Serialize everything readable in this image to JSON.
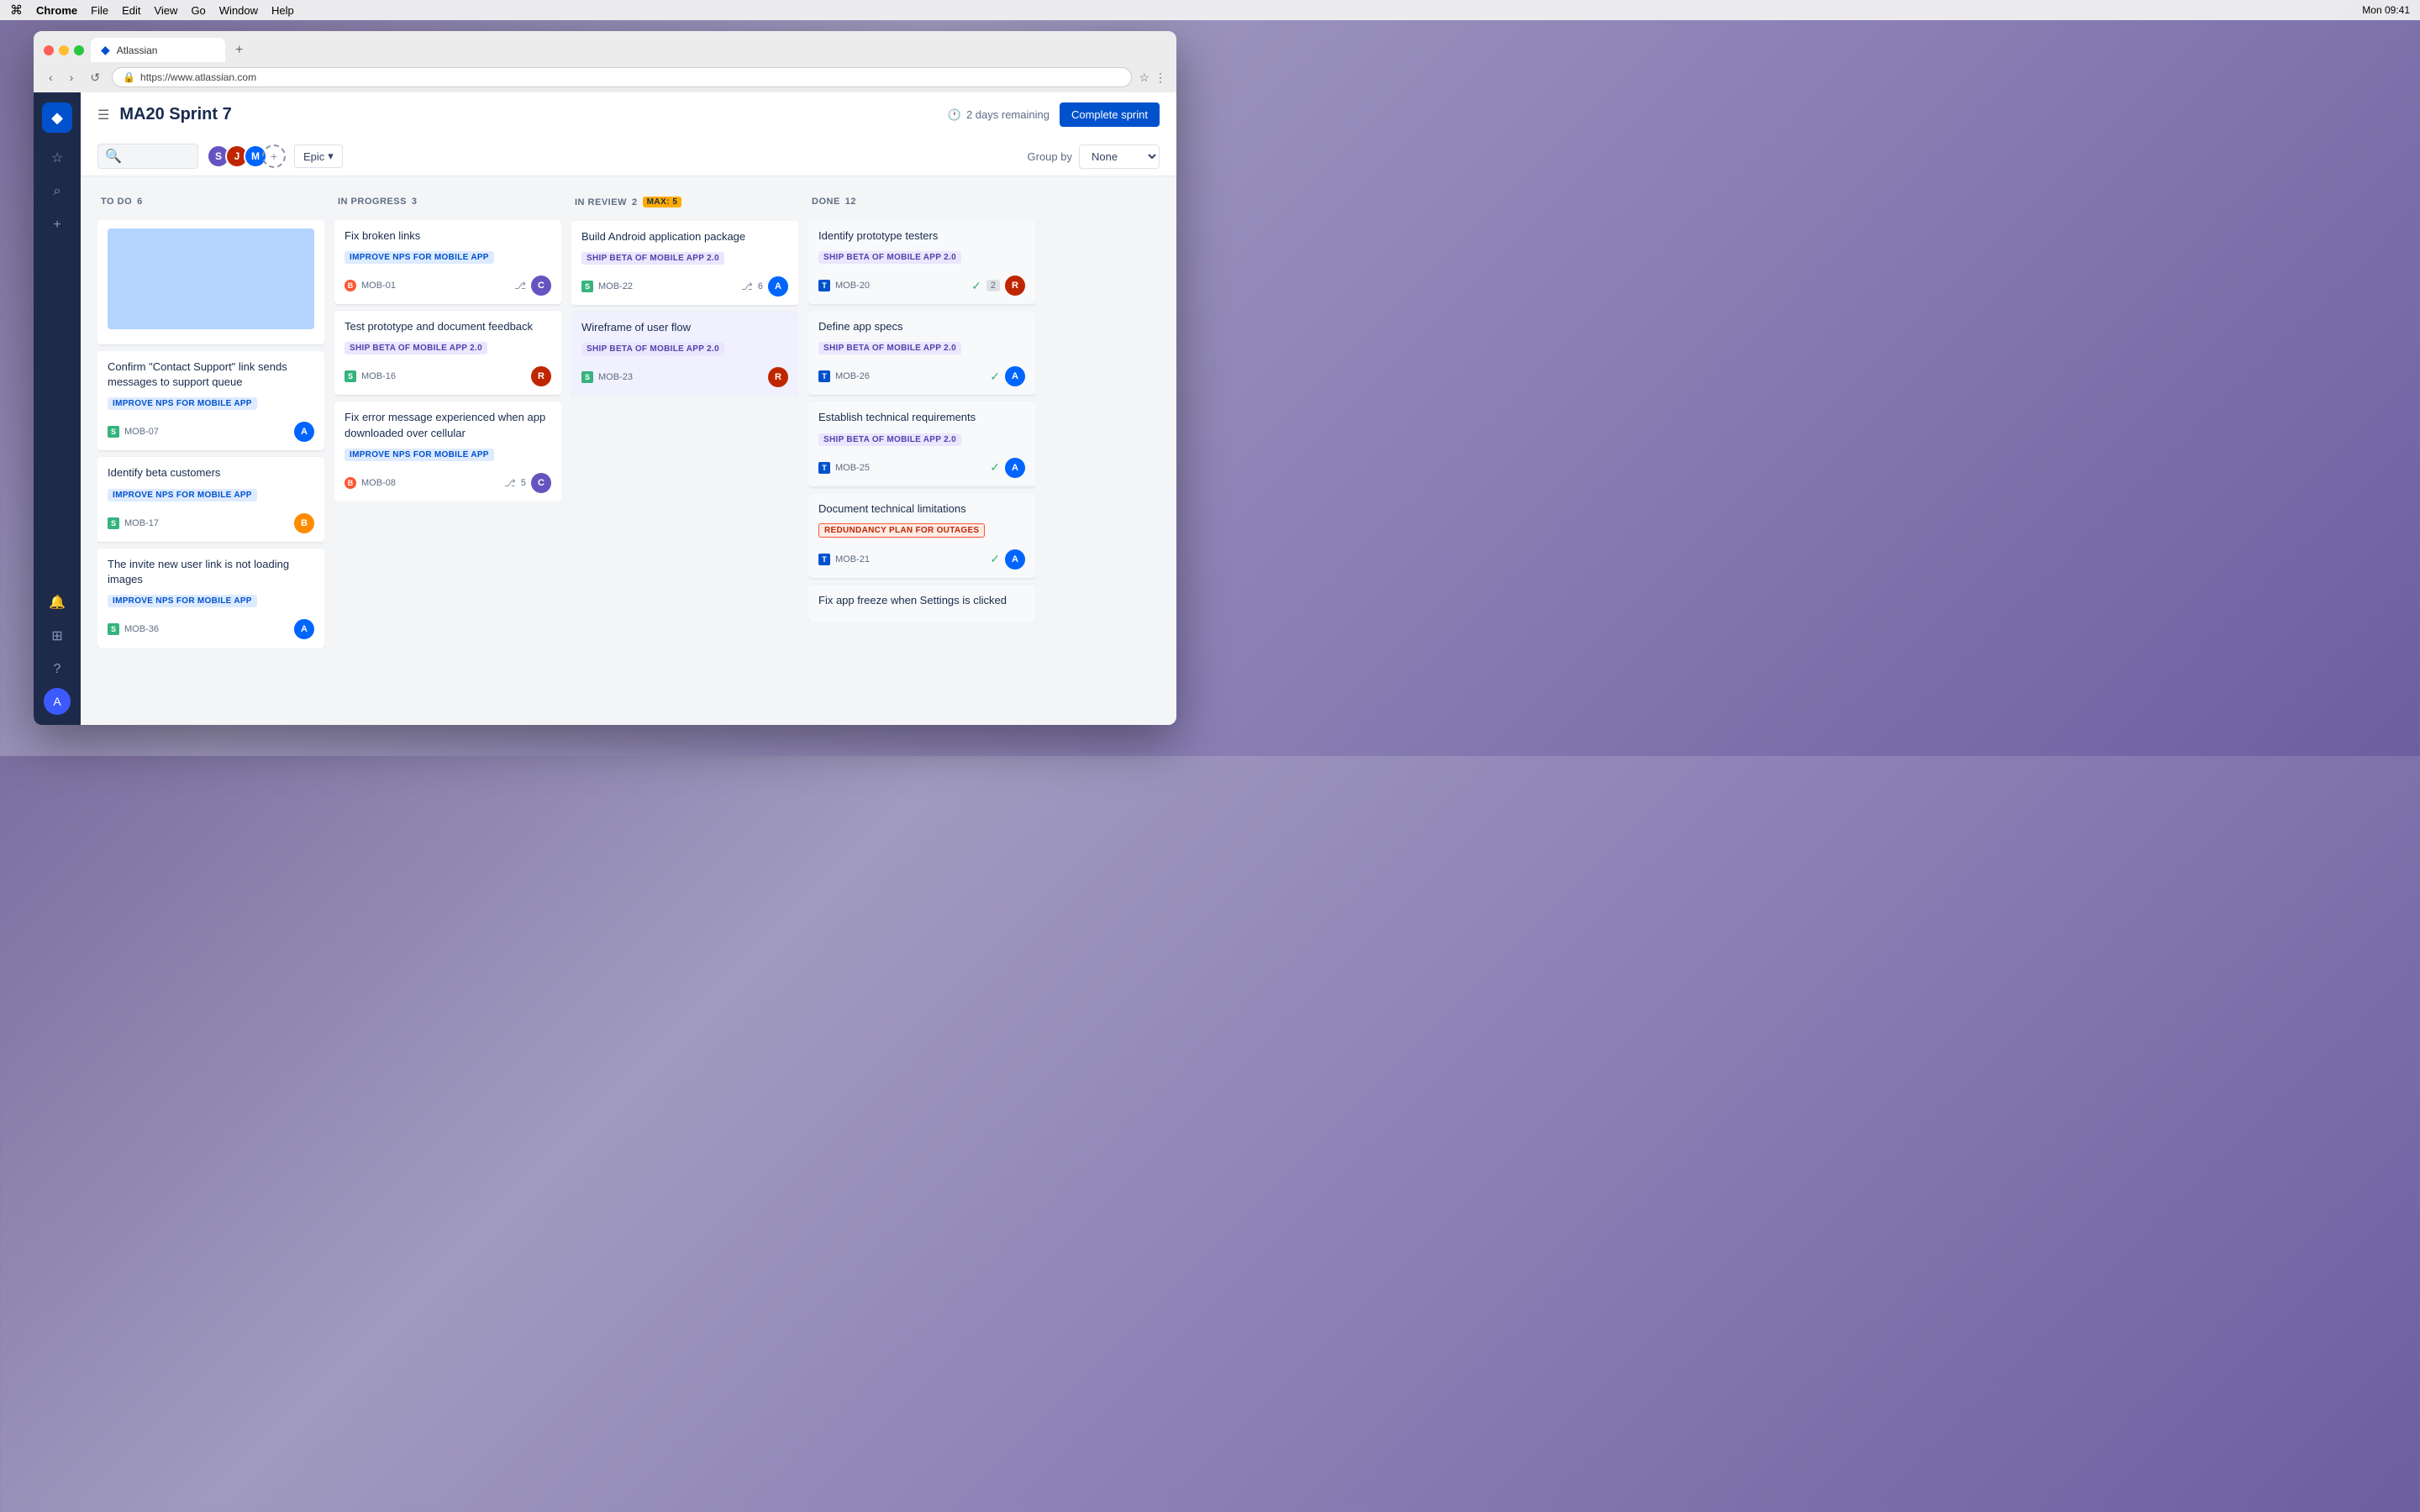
{
  "menubar": {
    "apple": "⌘",
    "app_name": "Chrome",
    "menus": [
      "File",
      "Edit",
      "View",
      "Go",
      "Window",
      "Help"
    ],
    "time": "Mon 09:41"
  },
  "browser": {
    "tab_title": "Atlassian",
    "url": "https://www.atlassian.com",
    "new_tab_label": "+"
  },
  "board": {
    "title": "MA20 Sprint 7",
    "days_remaining": "2 days remaining",
    "complete_sprint_btn": "Complete sprint",
    "filter": {
      "epic_label": "Epic",
      "group_by_label": "Group by",
      "group_by_value": "None"
    },
    "columns": [
      {
        "id": "todo",
        "title": "TO DO",
        "count": 6,
        "max": null,
        "cards": [
          {
            "id": "placeholder",
            "has_image": true,
            "title": null,
            "epic": null,
            "ticket_id": null,
            "ticket_type": null,
            "avatar_color": null,
            "story_points": null
          },
          {
            "id": "mob-07",
            "has_image": false,
            "title": "Confirm \"Contact Support\" link sends messages to support queue",
            "epic": "IMPROVE NPS FOR MOBILE APP",
            "epic_style": "blue",
            "ticket_id": "MOB-07",
            "ticket_type": "story",
            "avatar_color": "#0065ff",
            "story_points": null
          },
          {
            "id": "mob-17",
            "has_image": false,
            "title": "Identify beta customers",
            "epic": "IMPROVE NPS FOR MOBILE APP",
            "epic_style": "blue",
            "ticket_id": "MOB-17",
            "ticket_type": "story",
            "avatar_color": "#ff8b00",
            "story_points": null
          },
          {
            "id": "mob-36",
            "has_image": false,
            "title": "The invite new user link is not loading images",
            "epic": "IMPROVE NPS FOR MOBILE APP",
            "epic_style": "blue",
            "ticket_id": "MOB-36",
            "ticket_type": "story",
            "avatar_color": "#0065ff",
            "story_points": null
          }
        ]
      },
      {
        "id": "in-progress",
        "title": "IN PROGRESS",
        "count": 3,
        "max": null,
        "cards": [
          {
            "id": "mob-01",
            "title": "Fix broken links",
            "epic": "IMPROVE NPS FOR MOBILE APP",
            "epic_style": "blue",
            "ticket_id": "MOB-01",
            "ticket_type": "bug",
            "avatar_color": "#6554c0",
            "story_points": null,
            "has_branch": true
          },
          {
            "id": "mob-16",
            "title": "Test prototype and document feedback",
            "epic": "SHIP BETA OF MOBILE APP 2.0",
            "epic_style": "purple",
            "ticket_id": "MOB-16",
            "ticket_type": "story",
            "avatar_color": "#bf2600",
            "story_points": null,
            "has_branch": false
          },
          {
            "id": "mob-08",
            "title": "Fix error message experienced when app downloaded over cellular",
            "epic": "IMPROVE NPS FOR MOBILE APP",
            "epic_style": "blue",
            "ticket_id": "MOB-08",
            "ticket_type": "bug",
            "avatar_color": "#6554c0",
            "story_points": 5,
            "has_branch": true
          }
        ]
      },
      {
        "id": "in-review",
        "title": "IN REVIEW",
        "count": 2,
        "max": 5,
        "cards": [
          {
            "id": "mob-22",
            "title": "Build Android application package",
            "epic": "SHIP BETA OF MOBILE APP 2.0",
            "epic_style": "purple",
            "ticket_id": "MOB-22",
            "ticket_type": "story",
            "avatar_color": "#0065ff",
            "story_points": 6,
            "has_branch": true
          },
          {
            "id": "mob-23",
            "title": "Wireframe of user flow",
            "epic": "SHIP BETA OF MOBILE APP 2.0",
            "epic_style": "purple",
            "ticket_id": "MOB-23",
            "ticket_type": "story",
            "avatar_color": "#bf2600",
            "story_points": null,
            "has_branch": false,
            "highlighted": true
          }
        ]
      },
      {
        "id": "done",
        "title": "DONE",
        "count": 12,
        "max": null,
        "cards": [
          {
            "id": "mob-20",
            "title": "Identify prototype testers",
            "epic": "SHIP BETA OF MOBILE APP 2.0",
            "epic_style": "purple",
            "ticket_id": "MOB-20",
            "ticket_type": "task",
            "avatar_color": "#bf2600",
            "check_count": 2
          },
          {
            "id": "mob-26",
            "title": "Define app specs",
            "epic": "SHIP BETA OF MOBILE APP 2.0",
            "epic_style": "purple",
            "ticket_id": "MOB-26",
            "ticket_type": "task",
            "avatar_color": "#0065ff",
            "check_count": null
          },
          {
            "id": "mob-25",
            "title": "Establish technical requirements",
            "epic": "SHIP BETA OF MOBILE APP 2.0",
            "epic_style": "purple",
            "ticket_id": "MOB-25",
            "ticket_type": "task",
            "avatar_color": "#0065ff",
            "check_count": null
          },
          {
            "id": "mob-21",
            "title": "Document technical limitations",
            "epic": "REDUNDANCY PLAN FOR OUTAGES",
            "epic_style": "red",
            "ticket_id": "MOB-21",
            "ticket_type": "task",
            "avatar_color": "#0065ff",
            "check_count": null
          },
          {
            "id": "mob-last",
            "title": "Fix app freeze when Settings is clicked",
            "epic": null,
            "ticket_id": null,
            "ticket_type": null,
            "avatar_color": null,
            "check_count": null
          }
        ]
      }
    ]
  },
  "sidebar": {
    "logo_icon": "◆",
    "icons": [
      "☆",
      "⌕",
      "+"
    ],
    "bottom_icons": [
      "🔔",
      "⊞",
      "?"
    ]
  }
}
